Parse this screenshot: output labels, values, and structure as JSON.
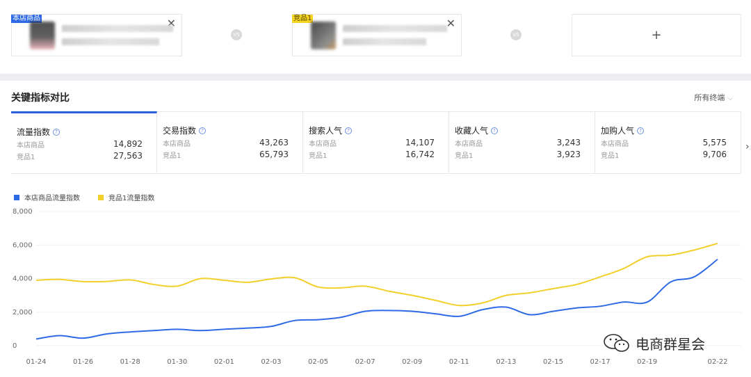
{
  "compare": {
    "card1_tag": "本店商品",
    "card2_tag": "竞品1",
    "close_glyph": "✕",
    "vs_label": "VS",
    "add_glyph": "+"
  },
  "section": {
    "title": "关键指标对比",
    "terminal": "所有终端"
  },
  "metrics": [
    {
      "title": "流量指数",
      "row1_label": "本店商品",
      "row1_value": "14,892",
      "row2_label": "竞品1",
      "row2_value": "27,563"
    },
    {
      "title": "交易指数",
      "row1_label": "本店商品",
      "row1_value": "43,263",
      "row2_label": "竞品1",
      "row2_value": "65,793"
    },
    {
      "title": "搜索人气",
      "row1_label": "本店商品",
      "row1_value": "14,107",
      "row2_label": "竞品1",
      "row2_value": "16,742"
    },
    {
      "title": "收藏人气",
      "row1_label": "本店商品",
      "row1_value": "3,243",
      "row2_label": "竞品1",
      "row2_value": "3,923"
    },
    {
      "title": "加购人气",
      "row1_label": "本店商品",
      "row1_value": "5,575",
      "row2_label": "竞品1",
      "row2_value": "9,706"
    }
  ],
  "next_glyph": "›",
  "help_glyph": "?",
  "colors": {
    "accent": "#2a62d8",
    "series_blue": "#2e6ae6",
    "series_yellow": "#f2cf2a"
  },
  "chart_data": {
    "type": "line",
    "ylim": [
      0,
      8000
    ],
    "yticks": [
      0,
      2000,
      4000,
      6000,
      8000
    ],
    "ytick_labels": [
      "0",
      "2,000",
      "4,000",
      "6,000",
      "8,000"
    ],
    "xtick_labels": [
      "01-24",
      "01-26",
      "01-28",
      "01-30",
      "02-01",
      "02-03",
      "02-05",
      "02-07",
      "02-09",
      "02-11",
      "02-13",
      "02-15",
      "02-17",
      "02-19",
      "02-22"
    ],
    "x": [
      "01-24",
      "01-25",
      "01-26",
      "01-27",
      "01-28",
      "01-29",
      "01-30",
      "01-31",
      "02-01",
      "02-02",
      "02-03",
      "02-04",
      "02-05",
      "02-06",
      "02-07",
      "02-08",
      "02-09",
      "02-10",
      "02-11",
      "02-12",
      "02-13",
      "02-14",
      "02-15",
      "02-16",
      "02-17",
      "02-18",
      "02-19",
      "02-20",
      "02-21",
      "02-22"
    ],
    "series": [
      {
        "name": "本店商品流量指数",
        "color": "#2e6ae6",
        "values": [
          400,
          600,
          450,
          700,
          820,
          900,
          980,
          900,
          980,
          1050,
          1150,
          1500,
          1550,
          1700,
          2050,
          2100,
          2050,
          1900,
          1750,
          2150,
          2300,
          1850,
          2050,
          2250,
          2350,
          2600,
          2600,
          3800,
          4100,
          5150
        ]
      },
      {
        "name": "竞品1流量指数",
        "color": "#f2cf2a",
        "values": [
          3900,
          3950,
          3820,
          3830,
          3920,
          3650,
          3550,
          4000,
          3900,
          3780,
          3980,
          4050,
          3500,
          3450,
          3550,
          3250,
          3000,
          2700,
          2400,
          2550,
          3000,
          3150,
          3400,
          3650,
          4100,
          4600,
          5300,
          5400,
          5700,
          6100
        ]
      }
    ]
  },
  "watermark": {
    "text": "电商群星会"
  }
}
